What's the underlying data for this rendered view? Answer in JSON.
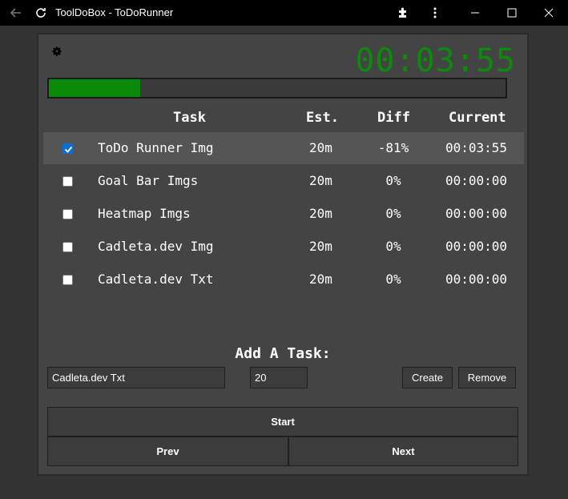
{
  "window": {
    "title": "ToolDoBox - ToDoRunner"
  },
  "timer": {
    "value": "00:03:55"
  },
  "progress": {
    "fraction": 0.2
  },
  "table": {
    "headers": {
      "task": "Task",
      "est": "Est.",
      "diff": "Diff",
      "current": "Current"
    },
    "rows": [
      {
        "checked": true,
        "task": "ToDo Runner Img",
        "est": "20m",
        "diff": "-81%",
        "current": "00:03:55"
      },
      {
        "checked": false,
        "task": "Goal Bar Imgs",
        "est": "20m",
        "diff": "0%",
        "current": "00:00:00"
      },
      {
        "checked": false,
        "task": "Heatmap Imgs",
        "est": "20m",
        "diff": "0%",
        "current": "00:00:00"
      },
      {
        "checked": false,
        "task": "Cadleta.dev Img",
        "est": "20m",
        "diff": "0%",
        "current": "00:00:00"
      },
      {
        "checked": false,
        "task": "Cadleta.dev Txt",
        "est": "20m",
        "diff": "0%",
        "current": "00:00:00"
      }
    ]
  },
  "add_task": {
    "label": "Add A Task:",
    "name_value": "Cadleta.dev Txt",
    "minutes_value": "20",
    "create_label": "Create",
    "remove_label": "Remove"
  },
  "controls": {
    "start_label": "Start",
    "prev_label": "Prev",
    "next_label": "Next"
  },
  "colors": {
    "accent_green": "#0a8a0a",
    "check_blue": "#0b6fd1"
  },
  "icons": [
    "back-arrow-icon",
    "refresh-icon",
    "extension-icon",
    "more-vert-icon",
    "minimize-icon",
    "maximize-icon",
    "close-icon",
    "gear-icon"
  ]
}
